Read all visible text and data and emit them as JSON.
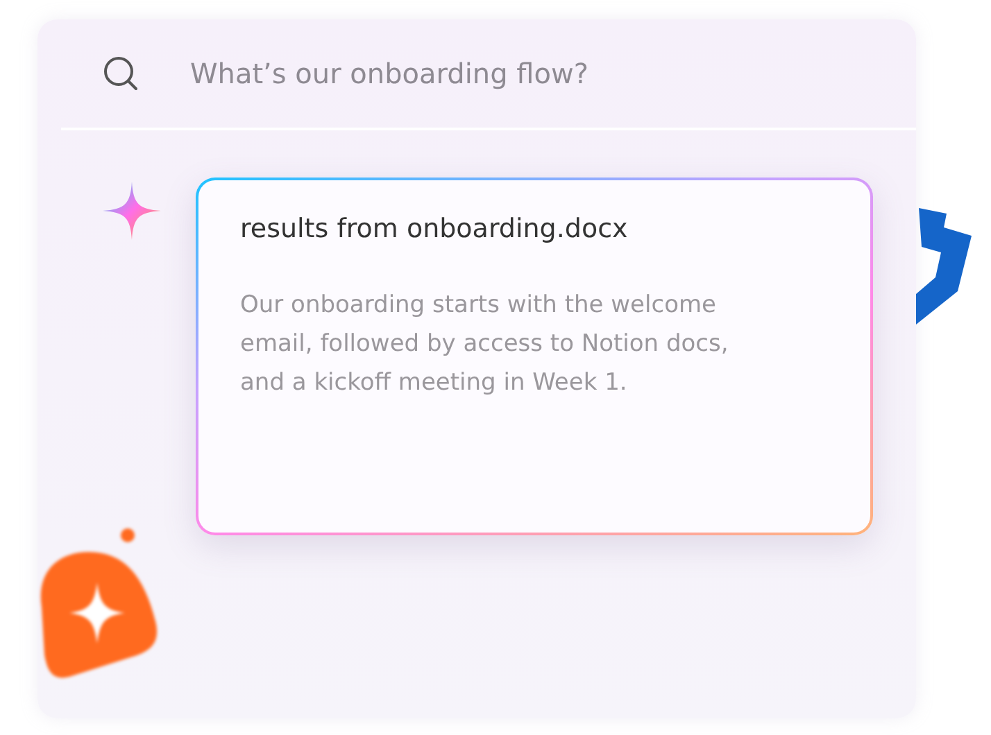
{
  "search": {
    "placeholder": "What’s our onboarding flow?"
  },
  "result": {
    "title": "results from onboarding.docx",
    "body": "Our onboarding starts with the welcome email, followed by access to Notion docs, and a kickoff meeting in Week 1."
  }
}
